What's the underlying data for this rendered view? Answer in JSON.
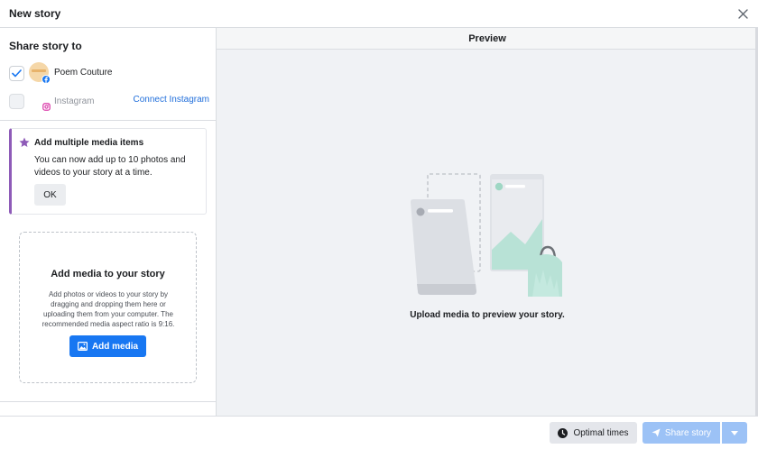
{
  "dialog": {
    "title": "New story"
  },
  "share": {
    "title": "Share story to",
    "accounts": [
      {
        "name": "Poem Couture",
        "platform": "facebook",
        "checked": true
      },
      {
        "name": "Instagram",
        "platform": "instagram",
        "checked": false,
        "action": "Connect Instagram"
      }
    ]
  },
  "notice": {
    "title": "Add multiple media items",
    "body": "You can now add up to 10 photos and videos to your story at a time.",
    "ok": "OK",
    "accent": "#8e5bb8"
  },
  "dropzone": {
    "title": "Add media to your story",
    "body": "Add photos or videos to your story by dragging and dropping them here or uploading them from your computer. The recommended media aspect ratio is 9:16.",
    "button": "Add media"
  },
  "preview": {
    "title": "Preview",
    "caption": "Upload media to preview your story."
  },
  "footer": {
    "optimal_times": "Optimal times",
    "share_story": "Share story"
  },
  "colors": {
    "primary": "#1877f2",
    "primary_disabled": "#9cc2f6",
    "link": "#216fdb",
    "mint": "#b8e2d6"
  },
  "icons": [
    "close-icon",
    "check-icon",
    "facebook-icon",
    "instagram-icon",
    "star-icon",
    "photo-icon",
    "clock-icon",
    "send-icon",
    "chevron-down-icon"
  ]
}
